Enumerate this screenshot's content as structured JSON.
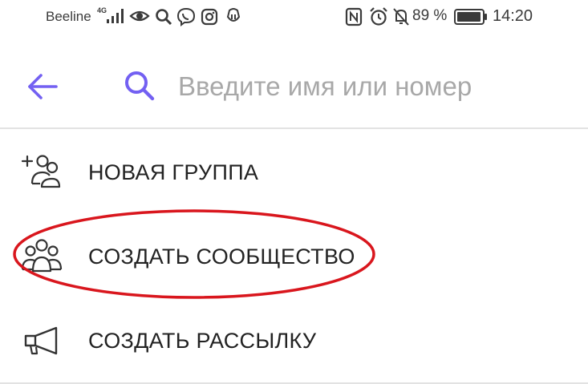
{
  "status_bar": {
    "carrier": "Beeline",
    "network_type": "4G",
    "battery_percent": "89 %",
    "time": "14:20",
    "icons": [
      "signal-icon",
      "eye-icon",
      "search-icon",
      "viber-icon",
      "instagram-icon",
      "app-icon",
      "nfc-icon",
      "alarm-icon",
      "mute-icon",
      "battery-icon"
    ]
  },
  "search": {
    "placeholder": "Введите имя или номер",
    "value": ""
  },
  "menu": {
    "items": [
      {
        "label": "НОВАЯ ГРУППА",
        "icon": "add-group-icon"
      },
      {
        "label": "СОЗДАТЬ СООБЩЕСТВО",
        "icon": "community-icon"
      },
      {
        "label": "СОЗДАТЬ РАССЫЛКУ",
        "icon": "megaphone-icon"
      }
    ]
  },
  "colors": {
    "accent": "#7360f2",
    "highlight": "#d9161d",
    "divider": "#e2e2e2",
    "placeholder": "#a8a8a8",
    "text": "#222222"
  }
}
